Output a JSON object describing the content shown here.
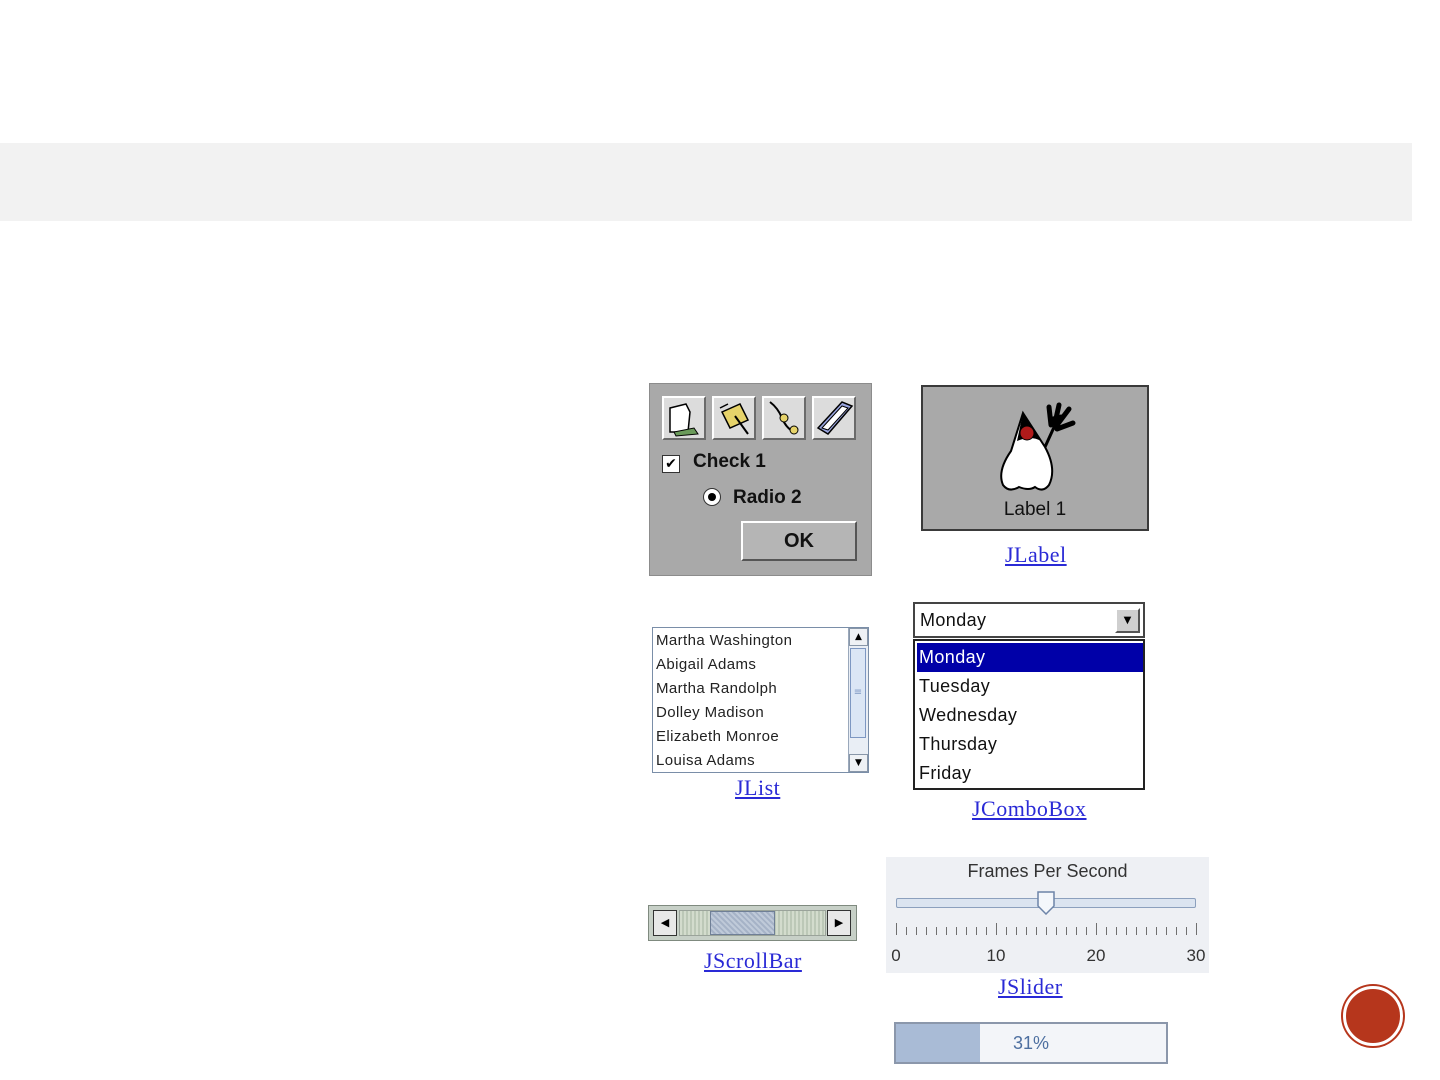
{
  "slide": {
    "accent": "#b6361c",
    "title_band_color": "#f2f2f2"
  },
  "panel": {
    "toolbar_icons": [
      "document-icon",
      "thumbtack-note-icon",
      "cable-plug-icon",
      "notebook-icon"
    ],
    "check_label": "Check 1",
    "check_mark": "✔",
    "radio_label": "Radio 2",
    "ok_label": "OK"
  },
  "jlabel": {
    "text": "Label 1",
    "icon": "duke-mascot-icon",
    "caption": "JLabel"
  },
  "jlist": {
    "items": [
      "Martha Washington",
      "Abigail Adams",
      "Martha Randolph",
      "Dolley Madison",
      "Elizabeth Monroe",
      "Louisa Adams"
    ],
    "caption": "JList"
  },
  "jcombobox": {
    "selected": "Monday",
    "options": [
      "Monday",
      "Tuesday",
      "Wednesday",
      "Thursday",
      "Friday"
    ],
    "highlight_color": "#0000a8",
    "caption": "JComboBox"
  },
  "jscrollbar": {
    "caption": "JScrollBar",
    "thumb_position_fraction": 0.37,
    "thumb_size_fraction": 0.45
  },
  "jslider": {
    "title": "Frames Per Second",
    "min": 0,
    "max": 30,
    "value": 15,
    "labels": [
      "0",
      "10",
      "20",
      "30"
    ],
    "caption": "JSlider"
  },
  "progress": {
    "value_fraction": 0.31,
    "text": "31%"
  }
}
